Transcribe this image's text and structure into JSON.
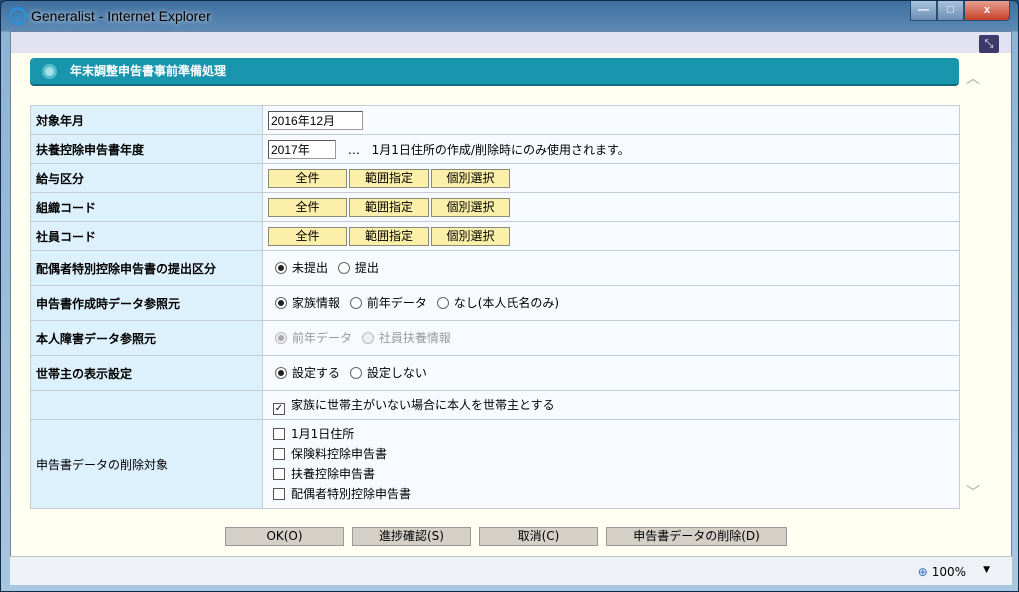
{
  "window": {
    "title": "Generalist - Internet Explorer",
    "minimize": "—",
    "maximize": "□",
    "close": "x"
  },
  "header": {
    "title": "年末調整申告書事前準備処理"
  },
  "rows": {
    "target_month": {
      "label": "対象年月",
      "value": "2016年12月"
    },
    "dependent_year": {
      "label": "扶養控除申告書年度",
      "value": "2017年",
      "ellipsis": "…",
      "note": "1月1日住所の作成/削除時にのみ使用されます。"
    },
    "salary": {
      "label": "給与区分"
    },
    "org": {
      "label": "組織コード"
    },
    "employee": {
      "label": "社員コード"
    },
    "spouse": {
      "label": "配偶者特別控除申告書の提出区分",
      "options": [
        "未提出",
        "提出"
      ]
    },
    "source": {
      "label": "申告書作成時データ参照元",
      "options": [
        "家族情報",
        "前年データ",
        "なし(本人氏名のみ)"
      ]
    },
    "disability": {
      "label": "本人障害データ参照元",
      "options": [
        "前年データ",
        "社員扶養情報"
      ]
    },
    "household": {
      "label": "世帯主の表示設定",
      "options": [
        "設定する",
        "設定しない"
      ]
    },
    "household_check": {
      "label": "家族に世帯主がいない場合に本人を世帯主とする"
    },
    "delete": {
      "label": "申告書データの削除対象",
      "items": [
        "1月1日住所",
        "保険料控除申告書",
        "扶養控除申告書",
        "配偶者特別控除申告書"
      ]
    }
  },
  "range_buttons": {
    "all": "全件",
    "range": "範囲指定",
    "individual": "個別選択"
  },
  "actions": {
    "ok": "OK(O)",
    "progress": "進捗確認(S)",
    "cancel": "取消(C)",
    "delete": "申告書データの削除(D)"
  },
  "status": {
    "zoom": "100%"
  }
}
